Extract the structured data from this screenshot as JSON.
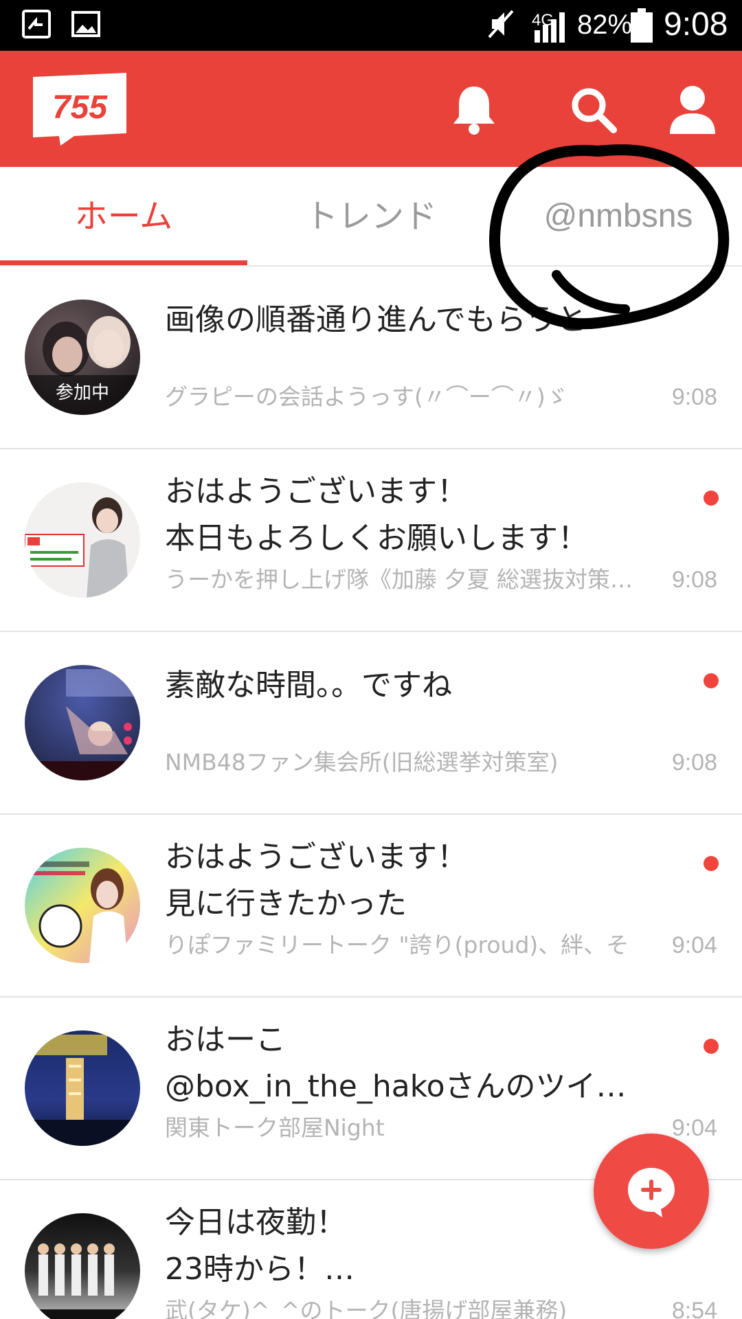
{
  "status_bar": {
    "network": "4G",
    "battery": "82%",
    "time": "9:08"
  },
  "header": {
    "logo_text": "755",
    "icons": [
      "bell-icon",
      "search-icon",
      "profile-icon"
    ]
  },
  "tabs": [
    {
      "label": "ホーム",
      "active": true
    },
    {
      "label": "トレンド",
      "active": false
    },
    {
      "label": "@nmbsns",
      "active": false
    }
  ],
  "feed": [
    {
      "message": "画像の順番通り進んでもらうと",
      "room": "グラピーの会話ようっす(〃⌒ー⌒〃)ゞ",
      "time": "9:08",
      "badge": "参加中",
      "unread": false
    },
    {
      "message": "おはようございます！\n本日もよろしくお願いします！",
      "room": "うーかを押し上げ隊《加藤 夕夏 総選抜対策…",
      "time": "9:08",
      "unread": true
    },
    {
      "message": "素敵な時間。。ですね",
      "room": "NMB48ファン集会所(旧総選挙対策室)",
      "time": "9:08",
      "unread": true
    },
    {
      "message": "おはようございます！\n見に行きたかった",
      "room": "りぽファミリートーク \"誇り(proud)、絆、そ",
      "time": "9:04",
      "unread": true
    },
    {
      "message": "おはーこ\n@box_in_the_hakoさんのツイ…",
      "room": "関東トーク部屋Night",
      "time": "9:04",
      "unread": true
    },
    {
      "message": "今日は夜勤！\n23時から！…",
      "room": "武(タケ)^_^のトーク(唐揚げ部屋兼務)",
      "time": "8:54",
      "unread": false
    }
  ],
  "colors": {
    "brand": "#e8423a",
    "unread_dot": "#f0443c",
    "muted_text": "#b4b4b4"
  }
}
